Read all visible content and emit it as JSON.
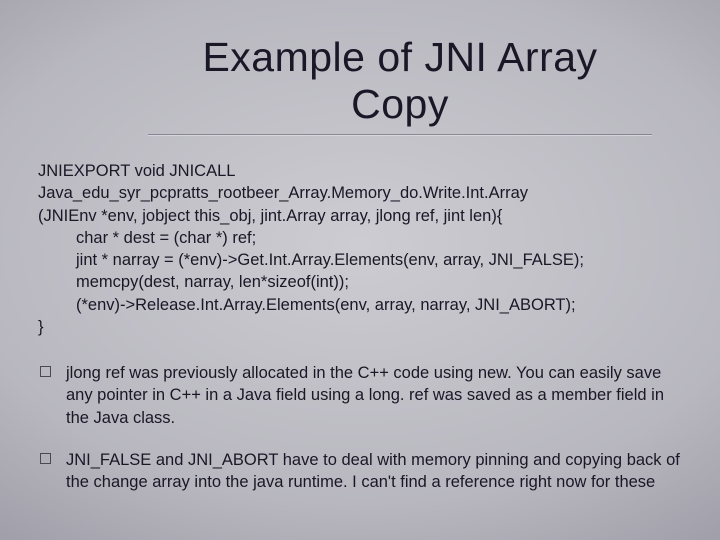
{
  "title": "Example of JNI Array Copy",
  "code": {
    "l1": "JNIEXPORT void JNICALL",
    "l2": "Java_edu_syr_pcpratts_rootbeer_Array.Memory_do.Write.Int.Array",
    "l3": "(JNIEnv *env, jobject this_obj, jint.Array array, jlong ref, jint len){",
    "l4": "char * dest = (char *) ref;",
    "l5": "jint * narray = (*env)->Get.Int.Array.Elements(env, array, JNI_FALSE);",
    "l6": "memcpy(dest, narray, len*sizeof(int));",
    "l7": "(*env)->Release.Int.Array.Elements(env, array, narray, JNI_ABORT);",
    "l8": "}"
  },
  "bullets": {
    "b1": "jlong ref was previously allocated in the C++ code using new. You can easily save any pointer in C++ in a Java field using a long. ref was saved as a member field in the Java class.",
    "b2": "JNI_FALSE and JNI_ABORT have to deal with memory pinning and copying back of the change array into the java runtime. I can't find a reference right now for these"
  }
}
